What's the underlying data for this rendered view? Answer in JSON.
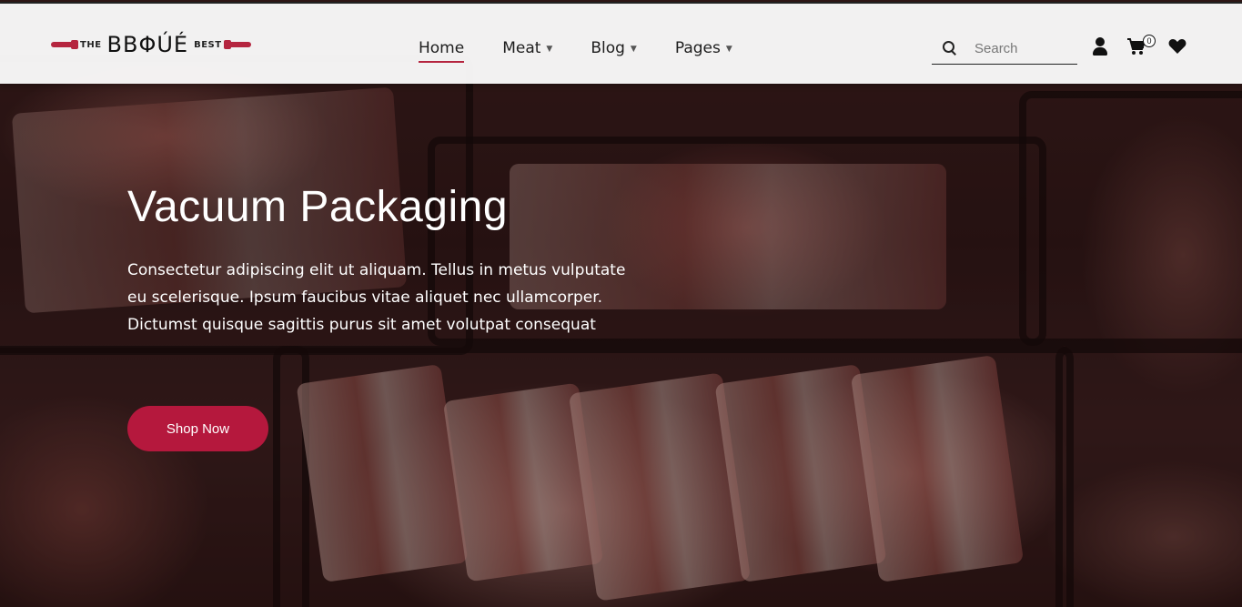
{
  "brand": {
    "prefix": "THE",
    "name": "ΒΒΦÚÉ",
    "suffix": "BEST",
    "accent_color": "#b5253f"
  },
  "nav": {
    "items": [
      {
        "label": "Home",
        "active": true,
        "dropdown": false
      },
      {
        "label": "Meat",
        "active": false,
        "dropdown": true
      },
      {
        "label": "Blog",
        "active": false,
        "dropdown": true
      },
      {
        "label": "Pages",
        "active": false,
        "dropdown": true
      }
    ]
  },
  "search": {
    "placeholder": "Search",
    "value": ""
  },
  "header_icons": {
    "user": "user-icon",
    "cart": "cart-icon",
    "cart_count": "0",
    "wishlist": "heart-icon"
  },
  "hero": {
    "title": "Vacuum Packaging",
    "text": "Consectetur adipiscing elit ut aliquam. Tellus in metus vulputate eu scelerisque. Ipsum faucibus vitae aliquet nec ullamcorper. Dictumst quisque sagittis purus sit amet volutpat consequat",
    "button_label": "Shop Now",
    "button_color": "#b5183d"
  }
}
